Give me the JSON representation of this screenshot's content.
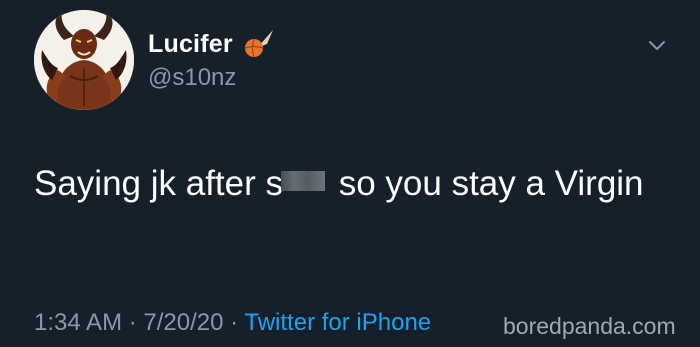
{
  "tweet": {
    "display_name": "Lucifer",
    "handle": "@s10nz",
    "emoji": "basketball-comet-icon",
    "text_part1": "Saying jk after s",
    "text_part2": " so you stay a Virgin",
    "time": "1:34 AM",
    "date": "7/20/20",
    "separator": "·",
    "source": "Twitter for iPhone"
  },
  "watermark": "boredpanda.com",
  "colors": {
    "background": "#15202b",
    "text": "#ffffff",
    "muted": "#8899a6",
    "link": "#1da1f2"
  }
}
